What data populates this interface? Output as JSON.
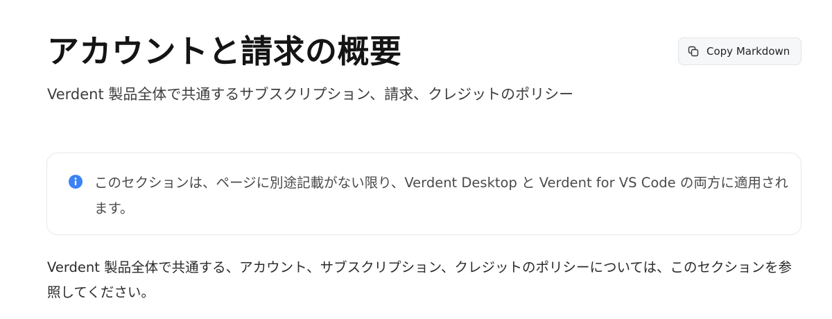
{
  "header": {
    "title": "アカウントと請求の概要",
    "subtitle": "Verdent 製品全体で共通するサブスクリプション、請求、クレジットのポリシー",
    "copy_button_label": "Copy Markdown"
  },
  "info_callout": {
    "icon": "info-icon",
    "text": "このセクションは、ページに別途記載がない限り、Verdent Desktop と Verdent for VS Code の両方に適用されます。"
  },
  "body": {
    "paragraph": "Verdent 製品全体で共通する、アカウント、サブスクリプション、クレジットのポリシーについては、このセクションを参照してください。"
  },
  "colors": {
    "info_icon": "#3b82f6",
    "title": "#141414"
  }
}
